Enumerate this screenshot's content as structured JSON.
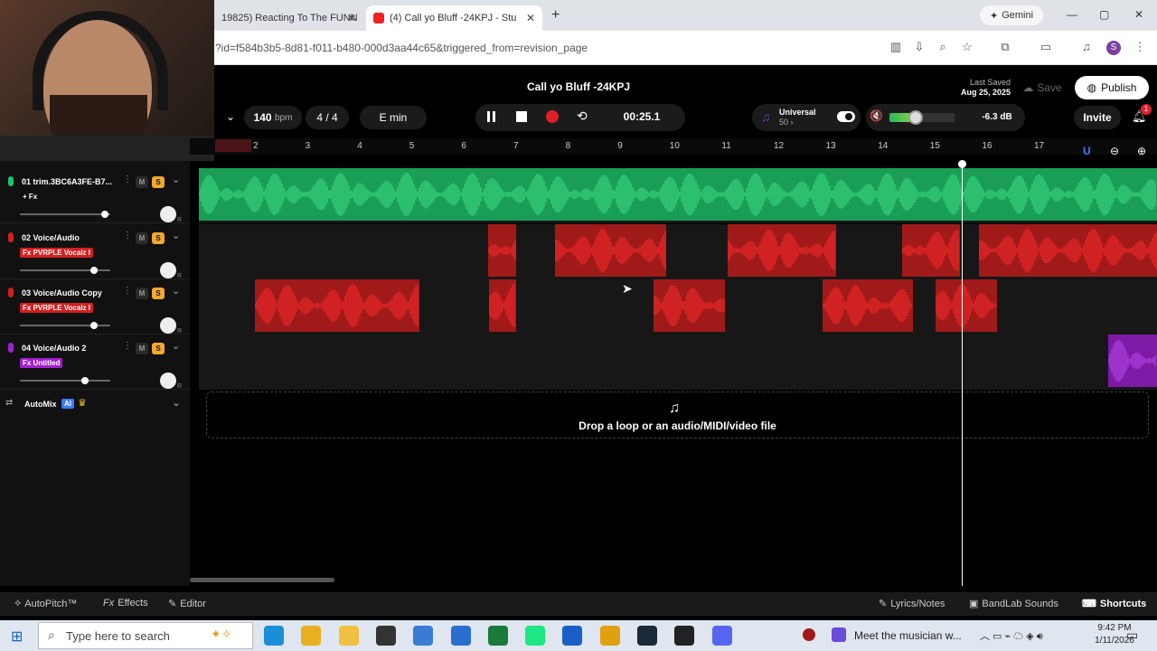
{
  "browser": {
    "tabs": [
      {
        "title": "19825) Reacting To The FUNN"
      },
      {
        "title": "(4) Call yo Bluff -24KPJ - Stu"
      }
    ],
    "url": "?id=f584b3b5-8d81-f011-b480-000d3aa44c65&triggered_from=revision_page",
    "gemini_label": "Gemini",
    "profile_initial": "S"
  },
  "studio": {
    "project_title": "Call yo Bluff -24KPJ",
    "last_saved_label": "Last Saved",
    "last_saved_date": "Aug 25, 2025",
    "save_label": "Save",
    "publish_label": "Publish",
    "bpm_value": "140",
    "bpm_unit": "bpm",
    "time_signature": "4 / 4",
    "key": "E min",
    "time": "00:25.1",
    "universal_label": "Universal",
    "universal_sub": "50 ›",
    "volume_db": "-6.3 dB",
    "volume_level_pct": 40,
    "invite_label": "Invite",
    "notif_count": "1"
  },
  "ruler": {
    "bars": [
      "2",
      "3",
      "4",
      "5",
      "6",
      "7",
      "8",
      "9",
      "10",
      "11",
      "12",
      "13",
      "14",
      "15",
      "16",
      "17"
    ]
  },
  "tracks": [
    {
      "name": "01  trim.3BC6A3FE-B7...",
      "fx": "+ Fx",
      "fx_color": "#000000",
      "color": "#1fc46a",
      "m": "M",
      "s": "S",
      "slider_pct": 90
    },
    {
      "name": "02  Voice/Audio",
      "fx": "Fx PVRPLE Vocalz I",
      "fx_color": "#d21f1f",
      "color": "#d21f1f",
      "m": "M",
      "s": "S",
      "slider_pct": 78
    },
    {
      "name": "03  Voice/Audio Copy",
      "fx": "Fx PVRPLE Vocalz I",
      "fx_color": "#d21f1f",
      "color": "#d21f1f",
      "m": "M",
      "s": "S",
      "slider_pct": 78
    },
    {
      "name": "04  Voice/Audio 2",
      "fx": "Fx Untitled",
      "fx_color": "#a020d0",
      "color": "#a020d0",
      "m": "M",
      "s": "S",
      "slider_pct": 68
    }
  ],
  "automix": {
    "label": "AutoMix",
    "ai_badge": "AI"
  },
  "dropzone": {
    "text": "Drop a loop or an audio/MIDI/video file"
  },
  "bottom": {
    "autopitch": "AutoPitch™",
    "effects": "Effects",
    "editor": "Editor",
    "lyrics": "Lyrics/Notes",
    "sounds": "BandLab Sounds",
    "shortcuts": "Shortcuts"
  },
  "taskbar": {
    "search_placeholder": "Type here to search",
    "news": "Meet the musician w...",
    "time": "9:42 PM",
    "date": "1/11/2026"
  }
}
